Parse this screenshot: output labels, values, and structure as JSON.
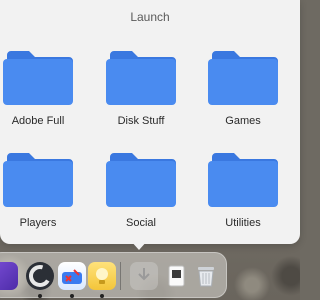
{
  "popover": {
    "title": "Launch",
    "folders": [
      {
        "label": "Adobe Full"
      },
      {
        "label": "Disk Stuff"
      },
      {
        "label": "Games"
      },
      {
        "label": "Players"
      },
      {
        "label": "Social"
      },
      {
        "label": "Utilities"
      }
    ]
  },
  "dock": {
    "items": [
      {
        "icon": "purple-app-icon"
      },
      {
        "icon": "app-c-icon"
      },
      {
        "icon": "weather-app-icon"
      },
      {
        "icon": "lightbulb-app-icon"
      },
      {
        "icon": "downloads-folder-icon"
      },
      {
        "icon": "document-stack-icon"
      },
      {
        "icon": "trash-icon"
      }
    ]
  },
  "colors": {
    "folder_front": "#4a8bf0",
    "folder_back": "#3a78e0",
    "panel": "#f2f2f2"
  }
}
